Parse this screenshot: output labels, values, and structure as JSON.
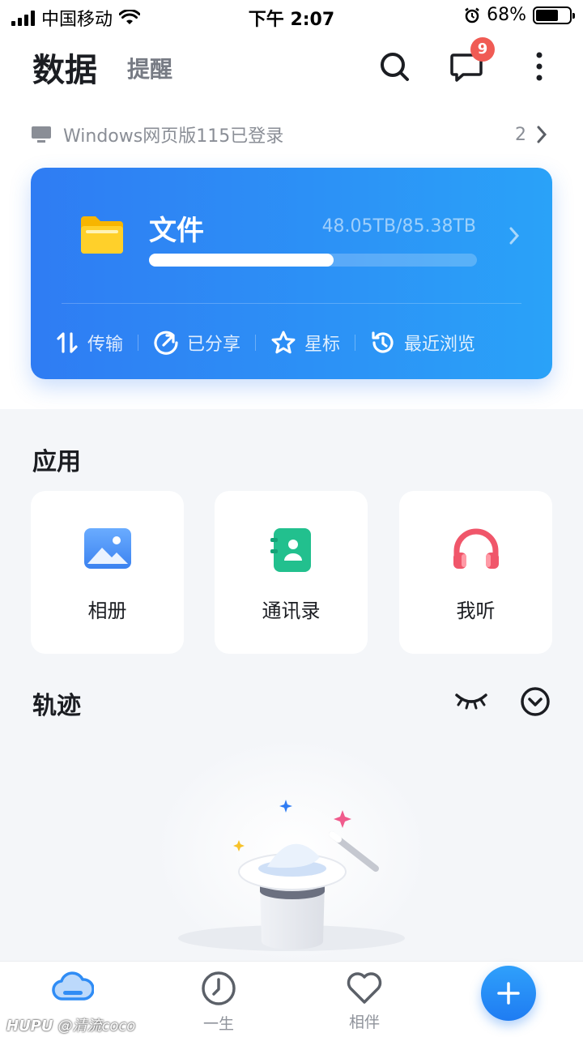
{
  "status_bar": {
    "carrier": "中国移动",
    "time": "下午 2:07",
    "battery": "68%",
    "battery_level": 0.68
  },
  "header": {
    "title": "数据",
    "tab_reminder": "提醒",
    "message_badge": "9"
  },
  "login_notice": {
    "text": "Windows网页版115已登录",
    "count": "2"
  },
  "files_card": {
    "title": "文件",
    "storage": "48.05TB/85.38TB",
    "usage_fraction": 0.5628,
    "actions": [
      {
        "label": "传输",
        "icon": "transfer-icon"
      },
      {
        "label": "已分享",
        "icon": "share-icon"
      },
      {
        "label": "星标",
        "icon": "star-icon"
      },
      {
        "label": "最近浏览",
        "icon": "recent-icon"
      }
    ]
  },
  "apps": {
    "title": "应用",
    "items": [
      {
        "label": "相册",
        "icon": "album-icon",
        "color": "#4a8ff5"
      },
      {
        "label": "通讯录",
        "icon": "contacts-icon",
        "color": "#22c08e"
      },
      {
        "label": "我听",
        "icon": "headphones-icon",
        "color": "#f0566a"
      }
    ]
  },
  "track": {
    "title": "轨迹"
  },
  "bottom_nav": {
    "items": [
      {
        "label": "",
        "icon": "cloud-icon"
      },
      {
        "label": "一生",
        "icon": "clock-icon"
      },
      {
        "label": "相伴",
        "icon": "heart-icon"
      }
    ],
    "fab_icon": "plus-icon"
  },
  "watermark": {
    "brand": "HUPU",
    "user": "@清流coco"
  },
  "colors": {
    "accent": "#2f7cf3",
    "badge": "#f05b54"
  }
}
